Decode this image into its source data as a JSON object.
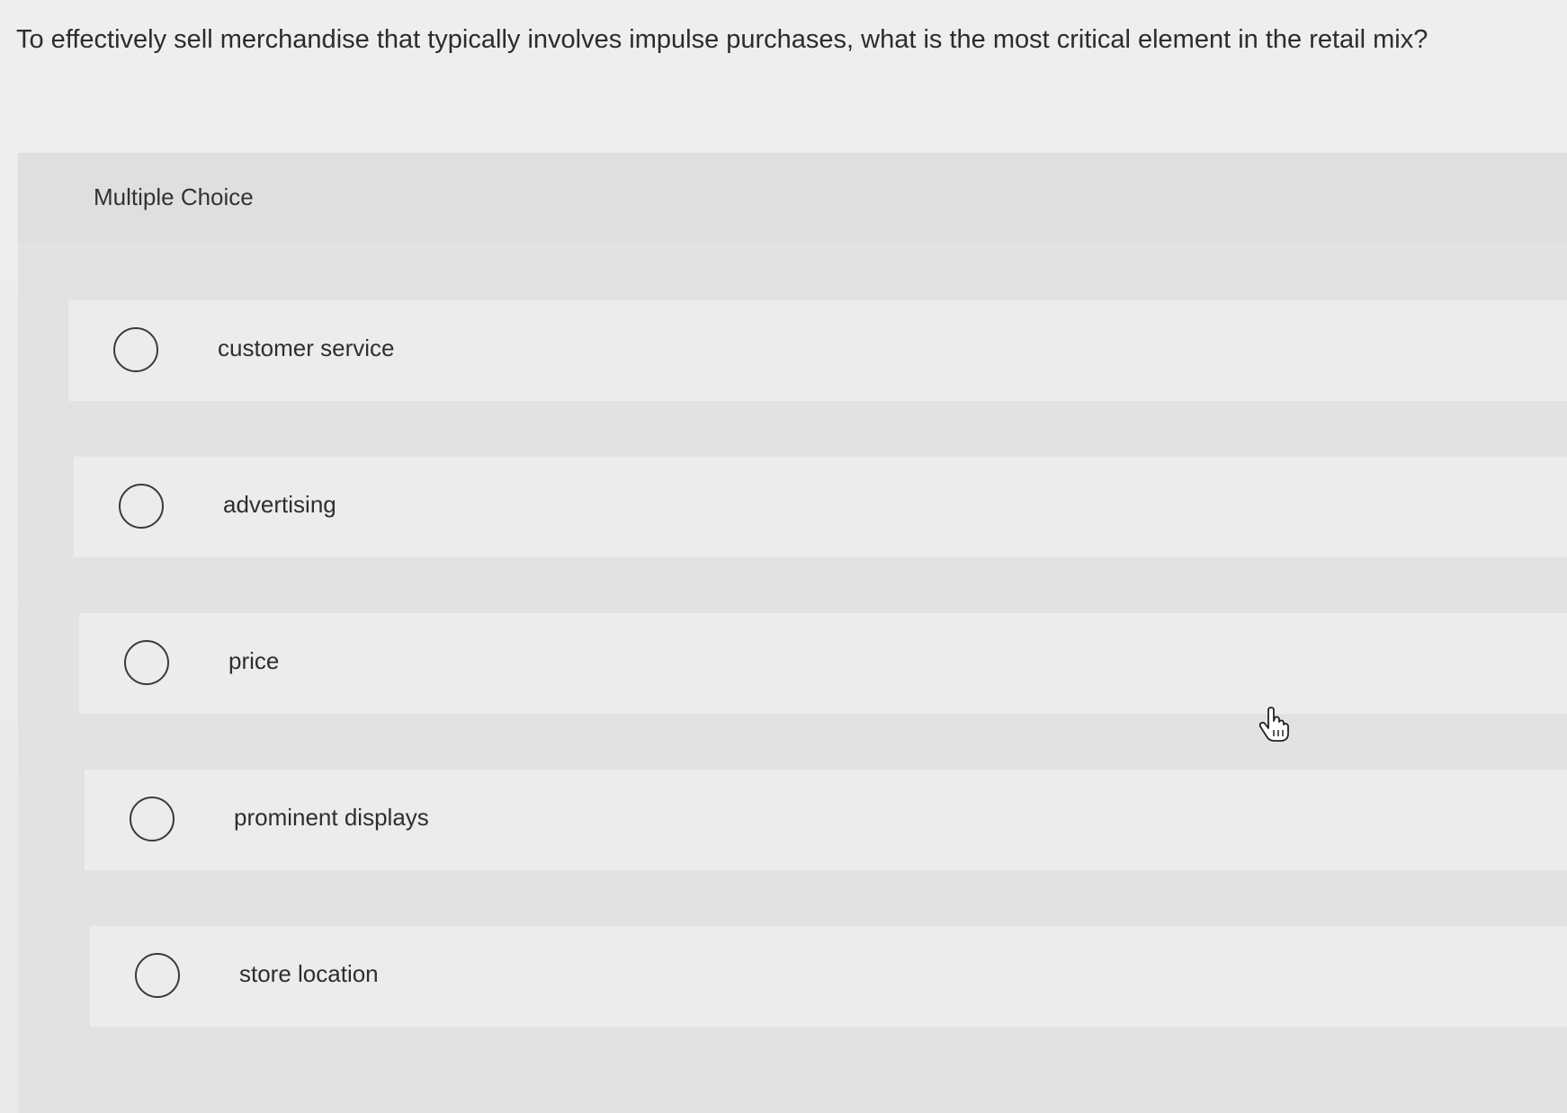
{
  "question": {
    "text": "To effectively sell merchandise that typically involves impulse purchases, what is the most critical element in the retail mix?"
  },
  "panel": {
    "title": "Multiple Choice",
    "options": [
      {
        "label": "customer service",
        "selected": false
      },
      {
        "label": "advertising",
        "selected": false
      },
      {
        "label": "price",
        "selected": false
      },
      {
        "label": "prominent displays",
        "selected": false
      },
      {
        "label": "store location",
        "selected": false
      }
    ]
  },
  "cursor": {
    "icon": "hand-pointer-icon"
  },
  "colors": {
    "background": "#eeeeee",
    "panel": "#e2e2e2",
    "option_row": "#ececec",
    "text": "#2c2c2c"
  }
}
